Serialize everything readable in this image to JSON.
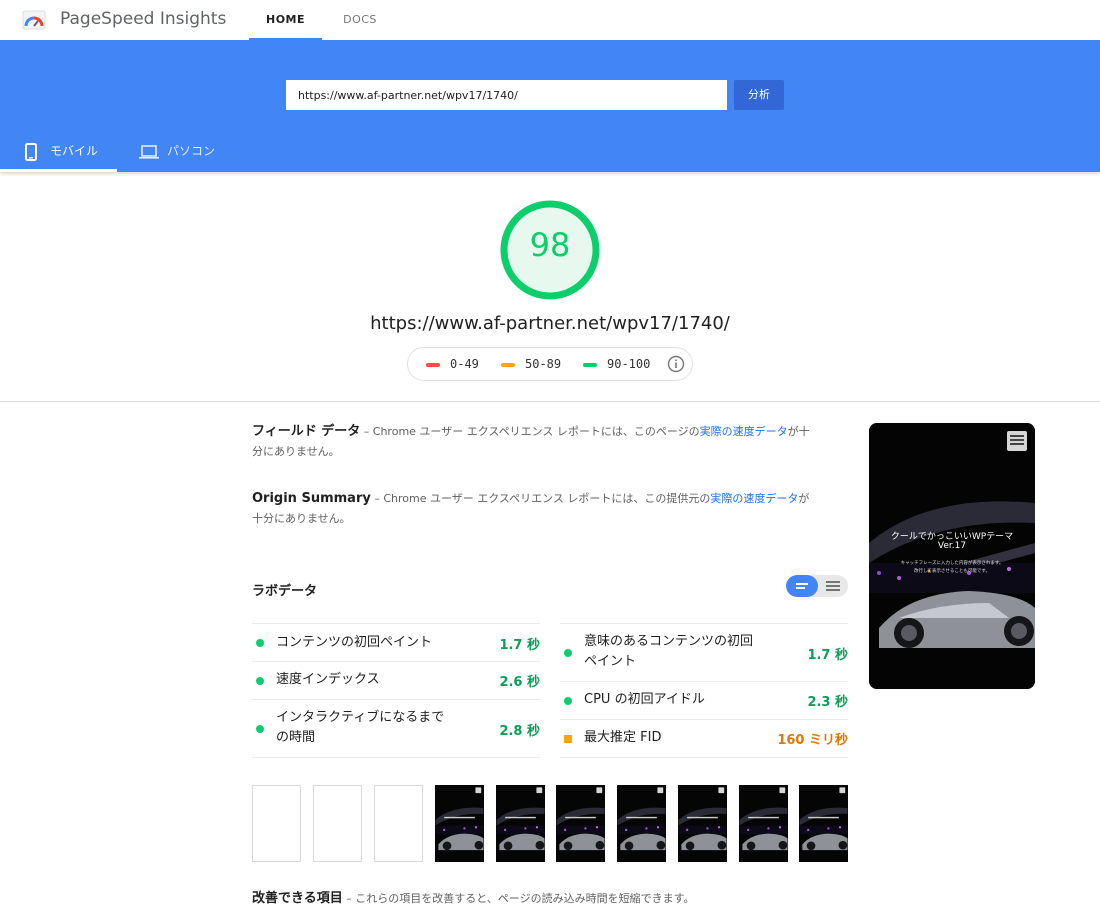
{
  "app": {
    "title": "PageSpeed Insights",
    "logo_icon": "pagespeed-gauge-icon"
  },
  "nav": {
    "tabs": [
      {
        "label": "HOME",
        "active": true
      },
      {
        "label": "DOCS",
        "active": false
      }
    ]
  },
  "search": {
    "url_value": "https://www.af-partner.net/wpv17/1740/",
    "analyze_label": "分析"
  },
  "device_tabs": [
    {
      "label": "モバイル",
      "icon": "smartphone-icon",
      "active": true
    },
    {
      "label": "パソコン",
      "icon": "laptop-icon",
      "active": false
    }
  ],
  "score": {
    "value": 98,
    "display": "98",
    "color": "#0cce6b"
  },
  "result_url": "https://www.af-partner.net/wpv17/1740/",
  "legend": [
    {
      "range": "0-49",
      "color": "#ff4e42"
    },
    {
      "range": "50-89",
      "color": "#ffa400"
    },
    {
      "range": "90-100",
      "color": "#0cce6b"
    }
  ],
  "field_data": {
    "title": "フィールド データ",
    "text": " – Chrome ユーザー エクスペリエンス レポートには、このページの",
    "link_text": "実際の速度データ",
    "text_after": "が十分にありません。"
  },
  "origin_summary": {
    "title": "Origin Summary",
    "text": " – Chrome ユーザー エクスペリエンス レポートには、この提供元の",
    "link_text": "実際の速度データ",
    "text_after": "が十分にありません。"
  },
  "screenshot": {
    "headline": "クールでかっこいいWPテーマ",
    "version": "Ver.17",
    "line1": "キャッチフレーズに入力した内容が表示されます。",
    "line2": "改行して表示させることも可能です。"
  },
  "lab_data": {
    "title": "ラボデータ",
    "left_metrics": [
      {
        "label": "コンテンツの初回ペイント",
        "value": "1.7 秒",
        "status": "pass"
      },
      {
        "label": "速度インデックス",
        "value": "2.6 秒",
        "status": "pass"
      },
      {
        "label": "インタラクティブになるまでの時間",
        "value": "2.8 秒",
        "status": "pass"
      }
    ],
    "right_metrics": [
      {
        "label": "意味のあるコンテンツの初回ペイント",
        "value": "1.7 秒",
        "status": "pass"
      },
      {
        "label": "CPU の初回アイドル",
        "value": "2.3 秒",
        "status": "pass"
      },
      {
        "label": "最大推定 FID",
        "value": "160 ミリ秒",
        "status": "average"
      }
    ]
  },
  "opportunities": {
    "title": "改善できる項目",
    "description": " – これらの項目を改善すると、ページの読み込み時間を短縮できます。"
  }
}
